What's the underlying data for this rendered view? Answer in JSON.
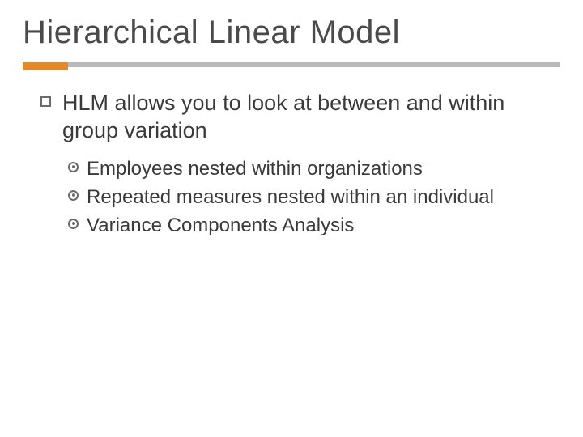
{
  "title": "Hierarchical Linear Model",
  "main_point": "HLM allows you to look at between and within group variation",
  "sub_points": {
    "p0": "Employees nested within organizations",
    "p1": "Repeated measures nested within an individual",
    "p2": "Variance Components Analysis"
  }
}
